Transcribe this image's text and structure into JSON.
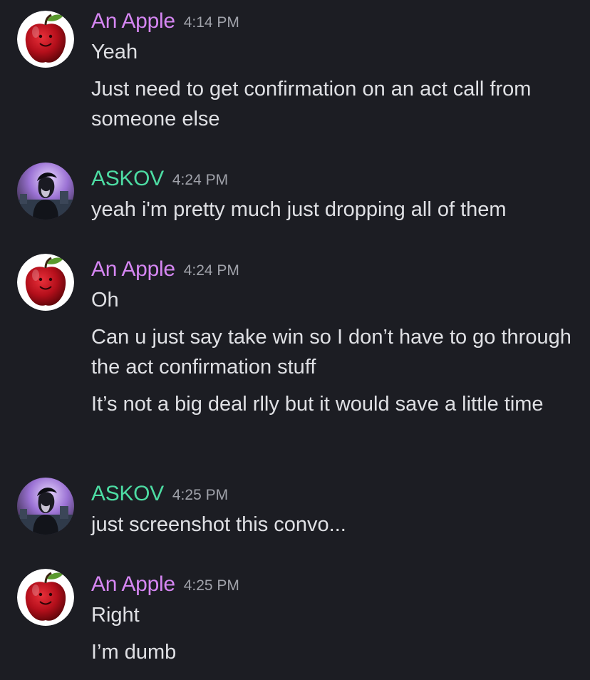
{
  "conversation": {
    "groups": [
      {
        "author": "An Apple",
        "time": "4:14 PM",
        "avatar_icon": "apple-face-avatar",
        "messages": [
          "Yeah",
          "Just need to get confirmation on an act call from someone else"
        ]
      },
      {
        "author": "ASKOV",
        "time": "4:24 PM",
        "avatar_icon": "anime-character-avatar",
        "messages": [
          "yeah i'm pretty much just dropping all of them"
        ]
      },
      {
        "author": "An Apple",
        "time": "4:24 PM",
        "avatar_icon": "apple-face-avatar",
        "messages": [
          "Oh",
          "Can u just say take win so I don’t have to go through the act confirmation stuff",
          "It’s not a big deal rlly but it would save a little time"
        ]
      },
      {
        "author": "ASKOV",
        "time": "4:25 PM",
        "avatar_icon": "anime-character-avatar",
        "messages": [
          "just screenshot this convo..."
        ]
      },
      {
        "author": "An Apple",
        "time": "4:25 PM",
        "avatar_icon": "apple-face-avatar",
        "messages": [
          "Right",
          "I’m dumb"
        ]
      }
    ]
  },
  "colors": {
    "background": "#1c1d23",
    "apple_name": "#d586f2",
    "askov_name": "#4ddca3",
    "timestamp": "#a0a2aa",
    "message_text": "#dfe0e4"
  }
}
